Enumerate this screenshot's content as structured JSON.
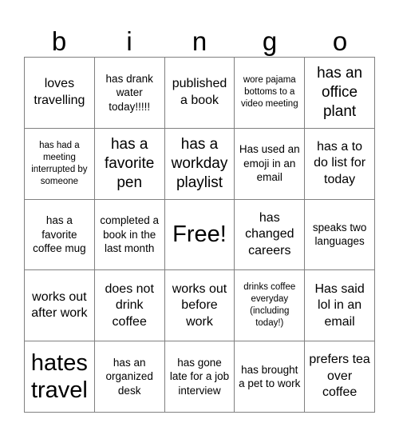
{
  "card": {
    "title": "bingo",
    "header_letters": [
      "b",
      "i",
      "n",
      "g",
      "o"
    ],
    "columns": 5,
    "rows": 5,
    "colors": {
      "background": "#ffffff",
      "text": "#000000",
      "grid_line": "#808080"
    },
    "free_space": {
      "label": "Free!",
      "row": 3,
      "column": 3
    },
    "cells": [
      {
        "text": "loves travelling",
        "size": "md"
      },
      {
        "text": "has drank water today!!!!!",
        "size": "sm"
      },
      {
        "text": "published a book",
        "size": "md"
      },
      {
        "text": "wore pajama bottoms to a video meeting",
        "size": "xs"
      },
      {
        "text": "has an office plant",
        "size": "lg"
      },
      {
        "text": "has had a meeting interrupted by someone",
        "size": "xs"
      },
      {
        "text": "has a favorite pen",
        "size": "lg"
      },
      {
        "text": "has a workday playlist",
        "size": "lg"
      },
      {
        "text": "Has used an emoji in an email",
        "size": "sm"
      },
      {
        "text": "has a to do list for today",
        "size": "md"
      },
      {
        "text": "has a favorite coffee mug",
        "size": "sm"
      },
      {
        "text": "completed a book in the last month",
        "size": "sm"
      },
      {
        "text": "Free!",
        "size": "xxl"
      },
      {
        "text": "has changed careers",
        "size": "md"
      },
      {
        "text": "speaks two languages",
        "size": "sm"
      },
      {
        "text": "works out after work",
        "size": "md"
      },
      {
        "text": "does not drink coffee",
        "size": "md"
      },
      {
        "text": "works out before work",
        "size": "md"
      },
      {
        "text": "drinks coffee everyday (including today!)",
        "size": "xs"
      },
      {
        "text": "Has said lol in an email",
        "size": "md"
      },
      {
        "text": "hates travel",
        "size": "xxl"
      },
      {
        "text": "has an organized desk",
        "size": "sm"
      },
      {
        "text": "has gone late for a job interview",
        "size": "sm"
      },
      {
        "text": "has brought a pet to work",
        "size": "sm"
      },
      {
        "text": "prefers tea over coffee",
        "size": "md"
      }
    ]
  }
}
